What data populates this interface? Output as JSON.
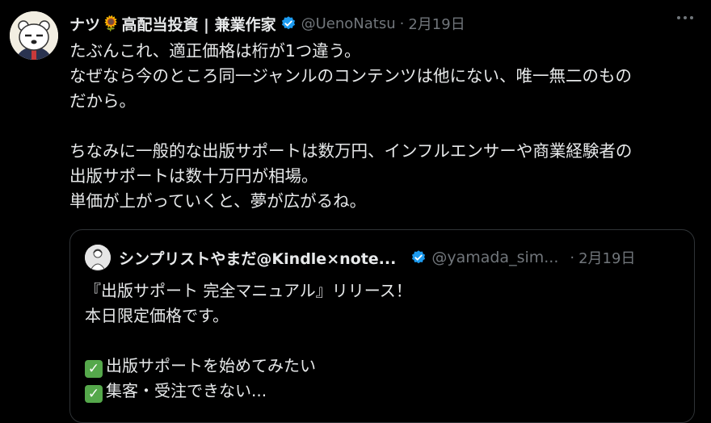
{
  "tweet": {
    "name": "ナツ",
    "emoji_icon": "sunflower-icon",
    "name_suffix": "高配当投資 | 兼業作家",
    "handle": "@UenoNatsu",
    "separator": "·",
    "date": "2月19日",
    "body_lines": [
      "たぶんこれ、適正価格は桁が1つ違う。",
      "なぜなら今のところ同一ジャンルのコンテンツは他にない、唯一無二のもの",
      "だから。",
      "",
      "ちなみに一般的な出版サポートは数万円、インフルエンサーや商業経験者の",
      "出版サポートは数十万円が相場。",
      "単価が上がっていくと、夢が広がるね。"
    ]
  },
  "quote": {
    "name": "シンプリストやまだ@Kindle×note...",
    "handle": "@yamada_sim...",
    "separator": "·",
    "date": "2月19日",
    "lines": [
      "『出版サポート 完全マニュアル』リリース！",
      "本日限定価格です。",
      "",
      "出版サポートを始めてみたい",
      "集客・受注できない..."
    ],
    "check_symbol": "✓"
  },
  "colors": {
    "background": "#000000",
    "text": "#e7e9ea",
    "muted": "#71767b",
    "verified": "#1d9bf0",
    "border": "#2f3336",
    "check": "#55a84b"
  }
}
